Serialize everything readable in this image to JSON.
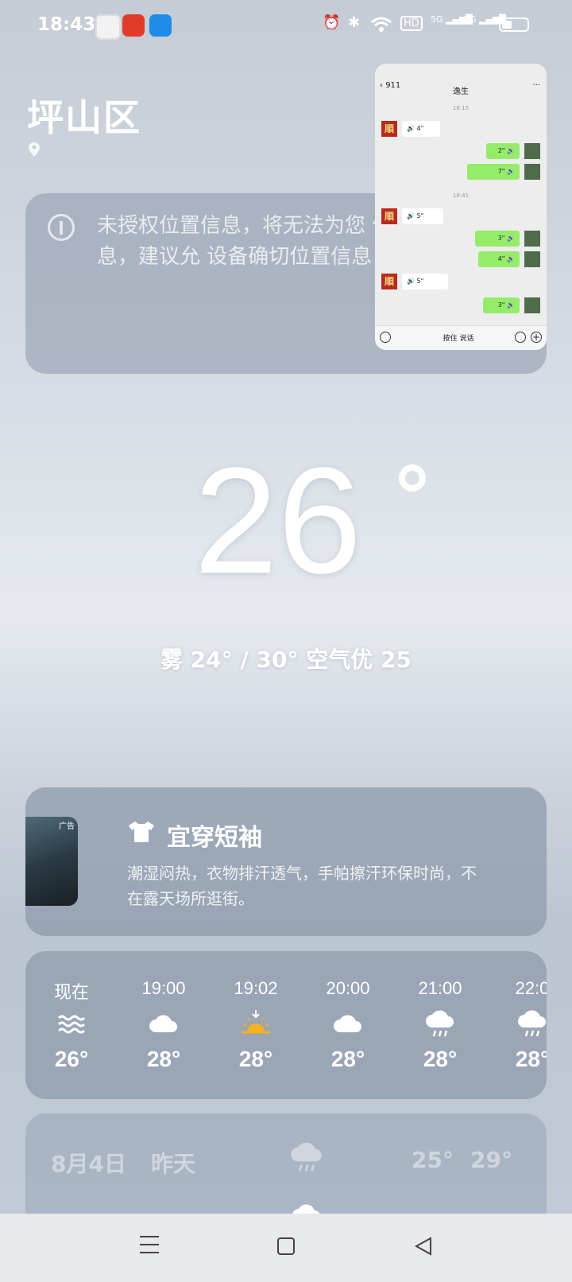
{
  "status_bar": {
    "time": "18:43",
    "hd": "HD",
    "net1": "5G",
    "net2": "5G"
  },
  "location": {
    "city": "坪山区"
  },
  "notice": {
    "text": "未授权位置信息，将无法为您 位置的精准天气信息，建议允 设备确切位置信息"
  },
  "pip_chat": {
    "back_count": "911",
    "title": "逸生",
    "time1": "18:15",
    "time2": "18:41",
    "messages": [
      {
        "side": "in",
        "text": "4\""
      },
      {
        "side": "out",
        "text": "2\""
      },
      {
        "side": "out",
        "text": "7\""
      },
      {
        "side": "in",
        "text": "5\""
      },
      {
        "side": "out",
        "text": "3\""
      },
      {
        "side": "out",
        "text": "4\""
      },
      {
        "side": "in",
        "text": "5\""
      },
      {
        "side": "out",
        "text": "3\""
      }
    ],
    "talk_label": "按住 说话"
  },
  "current": {
    "temperature": "26",
    "summary": "雾  24° / 30°  空气优 25"
  },
  "dress": {
    "ad_label": "广告",
    "title": "宜穿短袖",
    "description_line1": "潮湿闷热，衣物排汗透气，手帕擦汗环保时尚，不",
    "description_line2": "在露天场所逛街。"
  },
  "hourly": [
    {
      "time": "现在",
      "icon": "fog-icon",
      "temp": "26°"
    },
    {
      "time": "19:00",
      "icon": "cloud-icon",
      "temp": "28°"
    },
    {
      "time": "19:02",
      "icon": "sunset-icon",
      "temp": "28°"
    },
    {
      "time": "20:00",
      "icon": "cloud-icon",
      "temp": "28°"
    },
    {
      "time": "21:00",
      "icon": "rain-icon",
      "temp": "28°"
    },
    {
      "time": "22:0",
      "icon": "rain-icon",
      "temp": "28°"
    }
  ],
  "daily": {
    "date": "8月4日",
    "day": "昨天",
    "low": "25°",
    "high": "29°"
  },
  "colors": {
    "accent_sun": "#f5b21a",
    "wechat_green": "#95ec69"
  }
}
